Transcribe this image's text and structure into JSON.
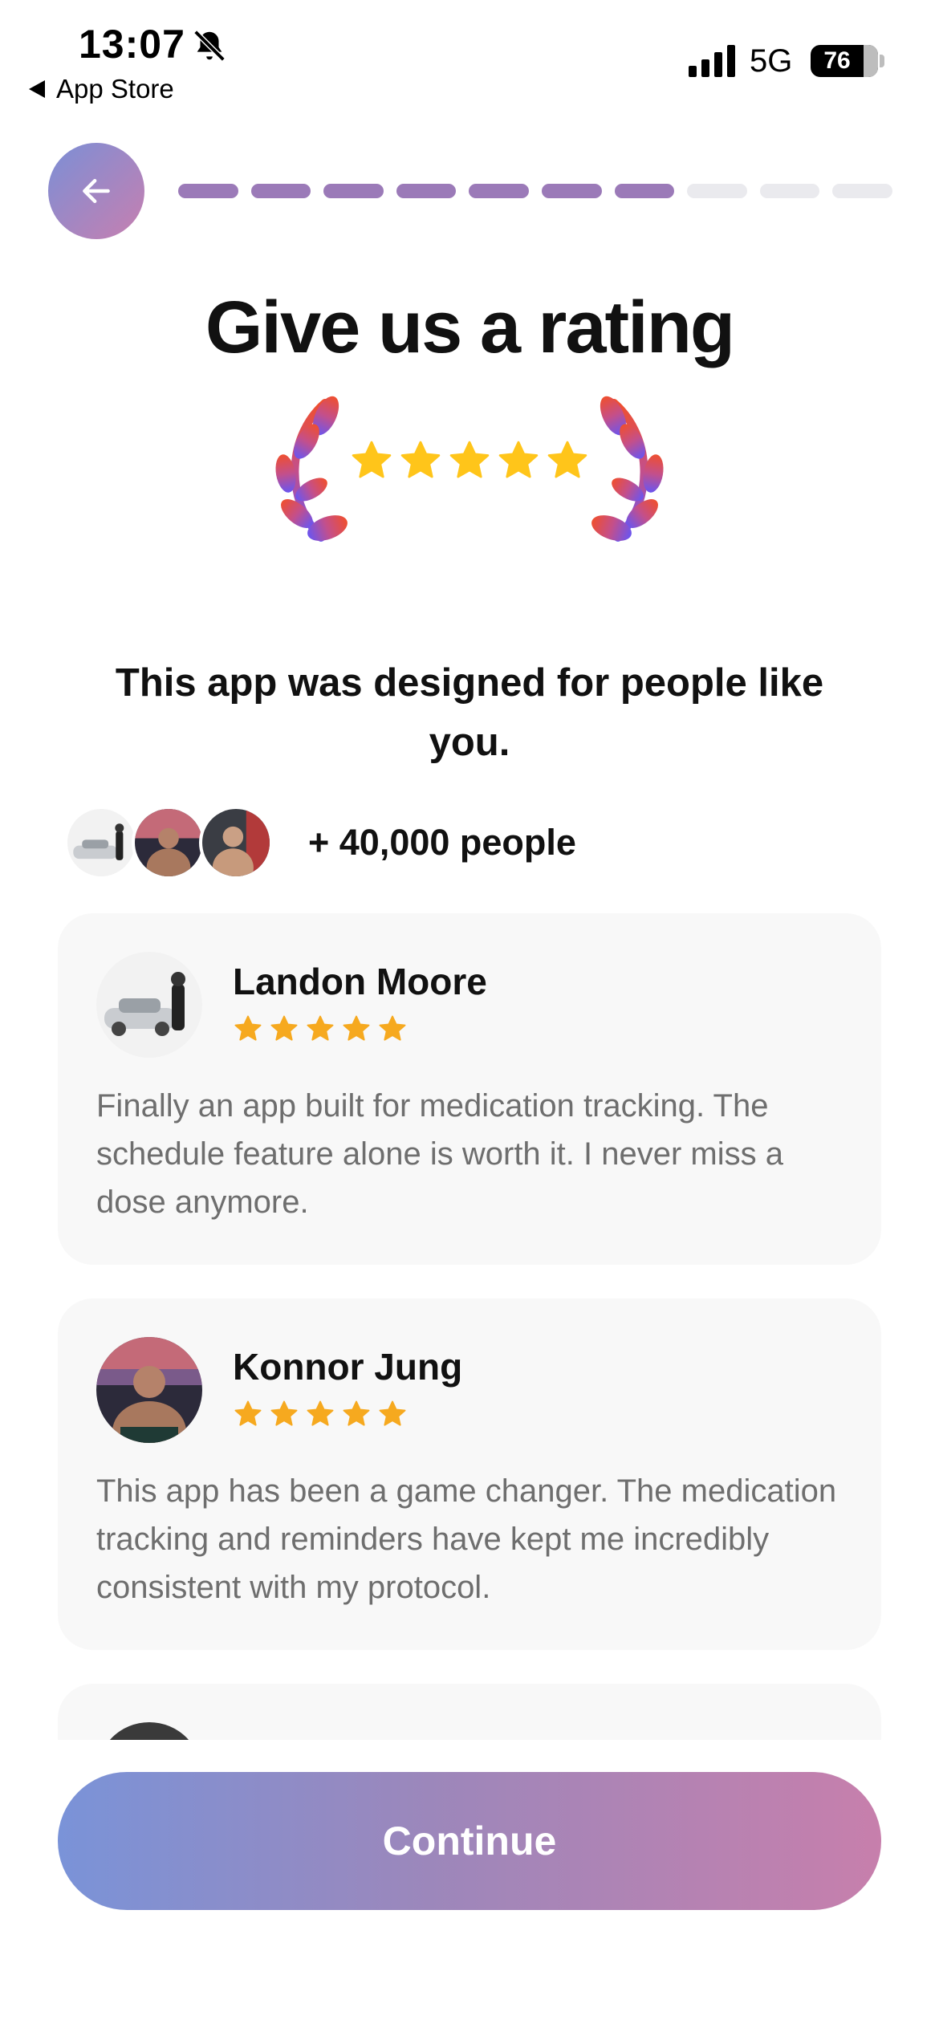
{
  "status_bar": {
    "time": "13:07",
    "back_app": "App Store",
    "network": "5G",
    "battery": "76"
  },
  "progress": {
    "total_steps": 10,
    "completed_steps": 7
  },
  "title": "Give us a rating",
  "badge": {
    "stars": 5
  },
  "subtitle": "This app was designed for people like you.",
  "people_count": "+ 40,000 people",
  "reviews": [
    {
      "name": "Landon Moore",
      "stars": 5,
      "text": "Finally an app built for medication tracking. The schedule feature alone is worth it. I never miss a dose anymore."
    },
    {
      "name": "Konnor Jung",
      "stars": 5,
      "text": "This app has been a game changer. The medication tracking and reminders have kept me incredibly consistent with my protocol."
    }
  ],
  "continue_label": "Continue",
  "colors": {
    "accent_start": "#7a93d8",
    "accent_end": "#c77fac",
    "progress_on": "#9b7ab8",
    "star": "#f6a91f",
    "badge_star": "#ffc51a"
  }
}
